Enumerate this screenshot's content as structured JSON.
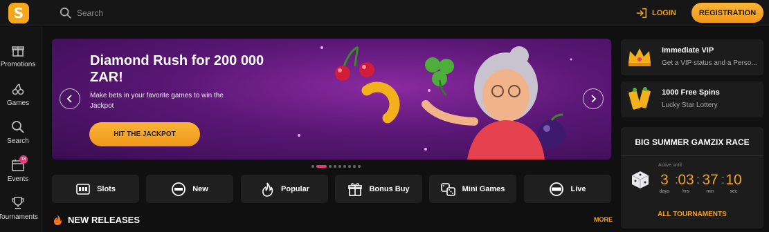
{
  "header": {
    "logo_letter": "S",
    "search_placeholder": "Search",
    "login_label": "LOGIN",
    "registration_label": "REGISTRATION"
  },
  "sidebar": {
    "items": [
      {
        "label": "Promotions",
        "icon": "gift-icon"
      },
      {
        "label": "Games",
        "icon": "cherries-icon"
      },
      {
        "label": "Search",
        "icon": "search-icon"
      },
      {
        "label": "Events",
        "icon": "calendar-icon",
        "badge": "18"
      },
      {
        "label": "Tournaments",
        "icon": "trophy-icon"
      }
    ]
  },
  "banner": {
    "title": "Diamond Rush for 200 000 ZAR!",
    "subtitle": "Make bets in your favorite games to win the Jackpot",
    "button_label": "HIT THE JACKPOT",
    "slide_count": 9,
    "active_slide": 2
  },
  "categories": [
    {
      "label": "Slots",
      "icon": "slot-machine-icon"
    },
    {
      "label": "New",
      "icon": "new-badge-icon"
    },
    {
      "label": "Popular",
      "icon": "fire-icon"
    },
    {
      "label": "Bonus Buy",
      "icon": "gift-icon"
    },
    {
      "label": "Mini Games",
      "icon": "dice-icon"
    },
    {
      "label": "Live",
      "icon": "live-icon"
    }
  ],
  "section": {
    "title": "NEW RELEASES",
    "more_label": "MORE"
  },
  "promos": [
    {
      "title": "Immediate VIP",
      "subtitle": "Get a VIP status and a Perso...",
      "icon": "crown-icon"
    },
    {
      "title": "1000 Free Spins",
      "subtitle": "Lucky Star Lottery",
      "icon": "lottery-tickets-icon"
    }
  ],
  "race": {
    "title": "BIG SUMMER GAMZIX RACE",
    "active_until_label": "Active until",
    "countdown": [
      {
        "value": "3",
        "unit": "days"
      },
      {
        "value": "03",
        "unit": "hrs"
      },
      {
        "value": "37",
        "unit": "min"
      },
      {
        "value": "10",
        "unit": "sec"
      }
    ],
    "all_tournaments_label": "ALL TOURNAMENTS"
  },
  "colors": {
    "accent": "#f2a21e",
    "banner_purple": "#5a1775",
    "badge_pink": "#e8397a"
  }
}
